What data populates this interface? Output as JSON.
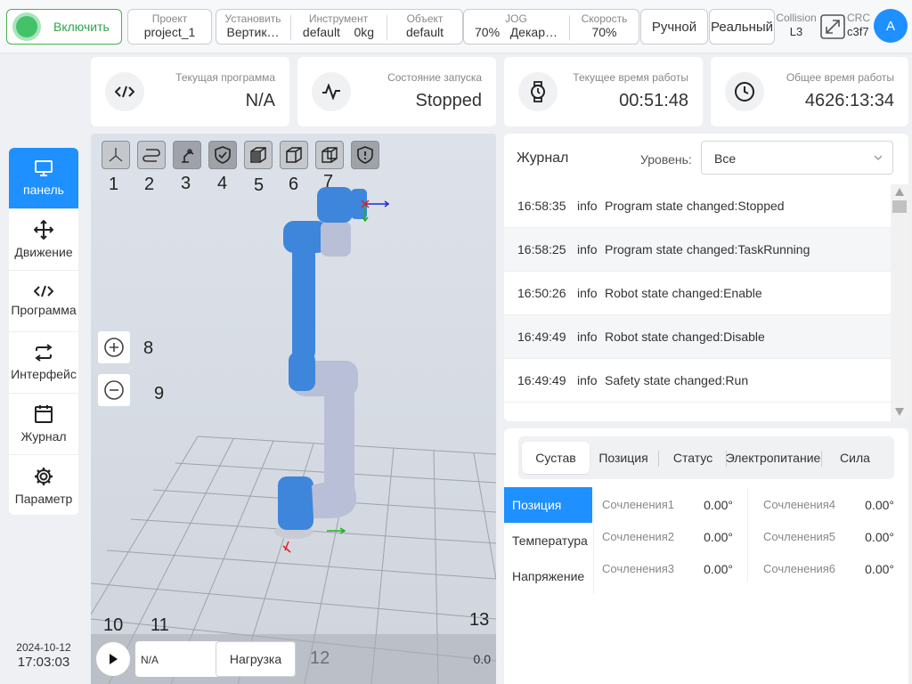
{
  "topbar": {
    "power_label": "Включить",
    "project": {
      "label": "Проект",
      "value": "project_1"
    },
    "install": {
      "label": "Установить",
      "value": "Вертик…"
    },
    "tool": {
      "label": "Инструмент",
      "value": "default",
      "load": "0kg"
    },
    "object": {
      "label": "Объект",
      "value": "default"
    },
    "jog": {
      "label": "JOG",
      "value": "70%",
      "mode": "Декар…"
    },
    "speed": {
      "label": "Скорость",
      "value": "70%"
    },
    "manual_label": "Ручной",
    "real_label": "Реальный",
    "collision": {
      "label": "Collision",
      "value": "L3"
    },
    "crc": {
      "label": "CRC",
      "value": "c3f7"
    },
    "avatar_letter": "A"
  },
  "status_cards": {
    "program": {
      "label": "Текущая программа",
      "value": "N/A",
      "icon": "code-icon"
    },
    "run_state": {
      "label": "Состояние запуска",
      "value": "Stopped",
      "icon": "pulse-icon"
    },
    "current_time": {
      "label": "Текущее время работы",
      "value": "00:51:48",
      "icon": "watch-icon"
    },
    "total_time": {
      "label": "Общее время работы",
      "value": "4626:13:34",
      "icon": "clock-icon"
    }
  },
  "sidebar": {
    "items": [
      {
        "label": "панель",
        "icon": "monitor-icon"
      },
      {
        "label": "Движение",
        "icon": "move-icon"
      },
      {
        "label": "Программа",
        "icon": "code-icon"
      },
      {
        "label": "Интерфейс",
        "icon": "swap-icon"
      },
      {
        "label": "Журнал",
        "icon": "calendar-icon"
      },
      {
        "label": "Параметр",
        "icon": "gear-icon"
      }
    ],
    "date": "2024-10-12",
    "time": "17:03:03"
  },
  "viewport": {
    "callouts": [
      "1",
      "2",
      "3",
      "4",
      "5",
      "6",
      "7",
      "8",
      "9",
      "10",
      "11",
      "12",
      "13"
    ],
    "program_value": "N/A",
    "load_button": "Нагрузка",
    "speed_value": "0.0",
    "colors": {
      "robot_blue": "#3d86dc",
      "robot_grey": "#b9bfd6"
    }
  },
  "log": {
    "title": "Журнал",
    "level_label": "Уровень:",
    "level_value": "Все",
    "rows": [
      {
        "time": "16:58:35",
        "level": "info",
        "message": "Program state changed:Stopped"
      },
      {
        "time": "16:58:25",
        "level": "info",
        "message": "Program state changed:TaskRunning"
      },
      {
        "time": "16:50:26",
        "level": "info",
        "message": "Robot state changed:Enable"
      },
      {
        "time": "16:49:49",
        "level": "info",
        "message": "Robot state changed:Disable"
      },
      {
        "time": "16:49:49",
        "level": "info",
        "message": "Safety state changed:Run"
      }
    ]
  },
  "joint_panel": {
    "tabs": [
      "Сустав",
      "Позиция",
      "Статус",
      "Электропитание",
      "Сила"
    ],
    "subnav": [
      "Позиция",
      "Температура",
      "Напряжение"
    ],
    "joints": [
      {
        "name": "Сочленения1",
        "value": "0.00°"
      },
      {
        "name": "Сочленения2",
        "value": "0.00°"
      },
      {
        "name": "Сочленения3",
        "value": "0.00°"
      },
      {
        "name": "Сочленения4",
        "value": "0.00°"
      },
      {
        "name": "Сочленения5",
        "value": "0.00°"
      },
      {
        "name": "Сочленения6",
        "value": "0.00°"
      }
    ]
  },
  "colors": {
    "accent": "#1e90ff",
    "power_green": "#43c26a"
  }
}
